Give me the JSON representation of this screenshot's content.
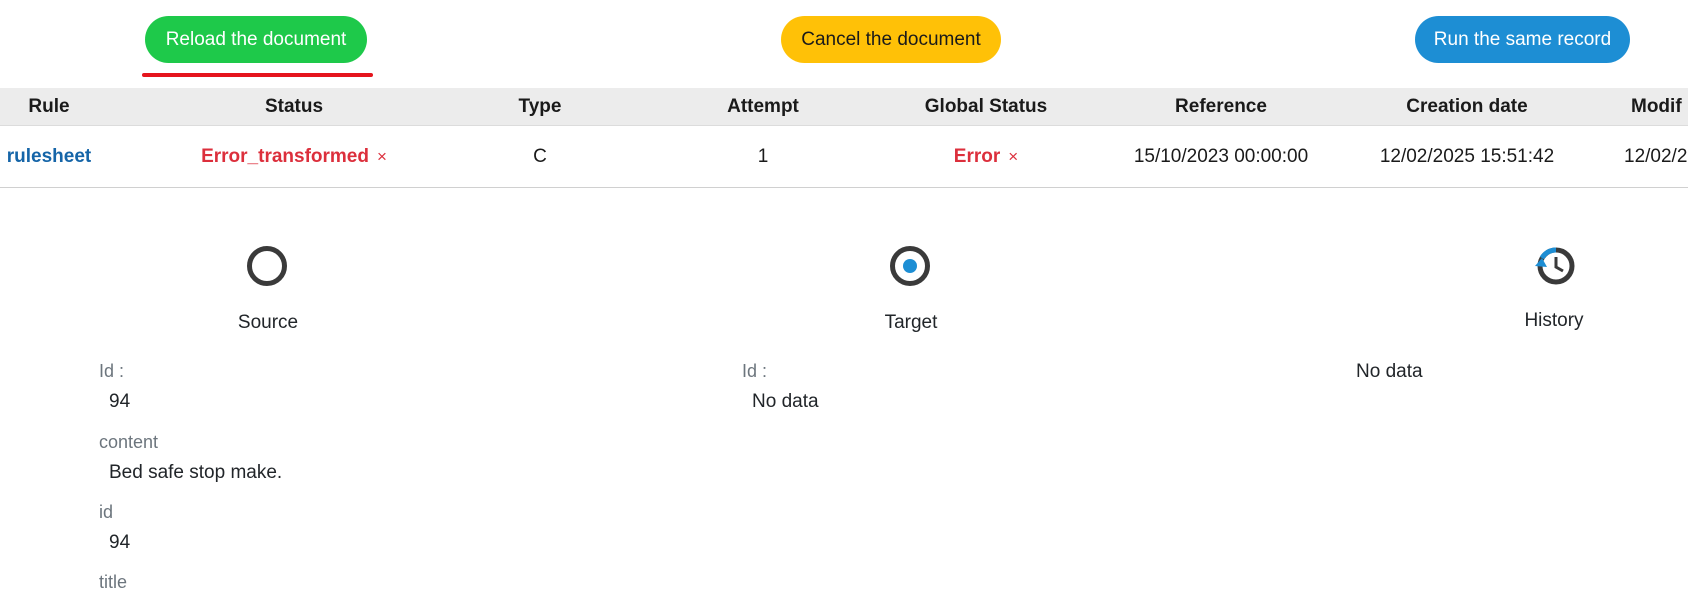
{
  "buttons": {
    "reload": "Reload the document",
    "cancel": "Cancel the document",
    "run": "Run the same record"
  },
  "colors": {
    "reload_bg": "#1ec94a",
    "cancel_bg": "#ffc107",
    "run_bg": "#1d8ed4",
    "error": "#dc2f3c",
    "link": "#1565a8"
  },
  "table": {
    "headers": [
      "Rule",
      "Status",
      "Type",
      "Attempt",
      "Global Status",
      "Reference",
      "Creation date",
      "Modif"
    ],
    "row": {
      "rule": "rulesheet",
      "status": "Error_transformed",
      "status_close": "×",
      "type": "C",
      "attempt": "1",
      "global_status": "Error",
      "global_status_close": "×",
      "reference": "15/10/2023 00:00:00",
      "creation_date": "12/02/2025 15:51:42",
      "modification_date": "12/02/2"
    }
  },
  "panels": {
    "source": {
      "title": "Source",
      "icon": "empty-circle-icon",
      "fields": [
        {
          "label": "Id :",
          "value": "94"
        },
        {
          "label": "content",
          "value": "Bed safe stop make."
        },
        {
          "label": "id",
          "value": "94"
        },
        {
          "label": "title",
          "value": ""
        }
      ]
    },
    "target": {
      "title": "Target",
      "icon": "radio-target-icon",
      "fields": [
        {
          "label": "Id :",
          "value": "No data"
        }
      ]
    },
    "history": {
      "title": "History",
      "icon": "history-icon",
      "empty_text": "No data"
    }
  }
}
